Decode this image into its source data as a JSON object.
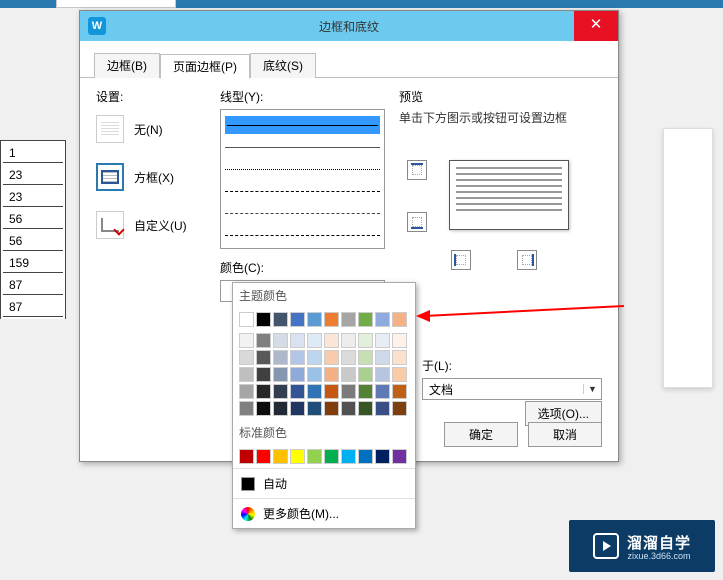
{
  "background_cells": [
    "1",
    "23",
    "23",
    "56",
    "56",
    "159",
    "87",
    "87"
  ],
  "dialog": {
    "title": "边框和底纹",
    "tabs": {
      "borders": "边框(B)",
      "page_border": "页面边框(P)",
      "shading": "底纹(S)"
    },
    "settings": {
      "label": "设置:",
      "none": "无(N)",
      "box": "方框(X)",
      "custom": "自定义(U)"
    },
    "line_style": {
      "label": "线型(Y):"
    },
    "color": {
      "label": "颜色(C):",
      "auto": "自动"
    },
    "preview": {
      "label": "预览",
      "hint": "单击下方图示或按钮可设置边框"
    },
    "apply_to": {
      "label": "于(L):",
      "value": "文档"
    },
    "options_btn": "选项(O)...",
    "ok": "确定",
    "cancel": "取消"
  },
  "color_popup": {
    "theme_label": "主题颜色",
    "standard_label": "标准颜色",
    "auto_label": "自动",
    "more_label": "更多颜色(M)...",
    "theme_row1": [
      "#ffffff",
      "#000000",
      "#44546a",
      "#4472c4",
      "#5b9bd5",
      "#ed7d31",
      "#a5a5a5",
      "#70ad47",
      "#8faadc",
      "#f4b183"
    ],
    "theme_shades": [
      [
        "#f2f2f2",
        "#808080",
        "#d6dce5",
        "#d9e1f2",
        "#deeaf6",
        "#fbe5d6",
        "#ededed",
        "#e2efda",
        "#e7ecf5",
        "#fdf2ea"
      ],
      [
        "#d9d9d9",
        "#595959",
        "#adb9ca",
        "#b4c6e7",
        "#bdd6ee",
        "#f8cbad",
        "#dbdbdb",
        "#c6e0b4",
        "#cfd9ea",
        "#fbe0cc"
      ],
      [
        "#bfbfbf",
        "#404040",
        "#8496b0",
        "#8ea9db",
        "#9bc2e6",
        "#f4b084",
        "#c9c9c9",
        "#a9d08e",
        "#b7c5e0",
        "#f9cba7"
      ],
      [
        "#a6a6a6",
        "#262626",
        "#333f4f",
        "#305496",
        "#2f75b5",
        "#c65911",
        "#7b7b7b",
        "#548235",
        "#5f79b5",
        "#c06014"
      ],
      [
        "#808080",
        "#0d0d0d",
        "#222b35",
        "#203764",
        "#1f4e78",
        "#833c0c",
        "#525252",
        "#375623",
        "#3a4f85",
        "#7c3f0d"
      ]
    ],
    "standard": [
      "#c00000",
      "#ff0000",
      "#ffc000",
      "#ffff00",
      "#92d050",
      "#00b050",
      "#00b0f0",
      "#0070c0",
      "#002060",
      "#7030a0"
    ]
  },
  "brand": {
    "name": "溜溜自学",
    "sub": "zixue.3d66.com"
  }
}
